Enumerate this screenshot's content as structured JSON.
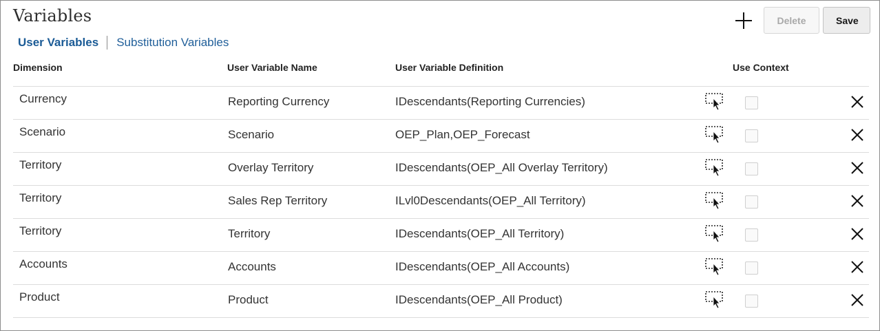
{
  "page": {
    "title": "Variables"
  },
  "toolbar": {
    "add_icon": "plus-icon",
    "delete_label": "Delete",
    "save_label": "Save"
  },
  "tabs": [
    {
      "label": "User Variables",
      "active": true
    },
    {
      "label": "Substitution Variables",
      "active": false
    }
  ],
  "columns": {
    "dimension": "Dimension",
    "name": "User Variable Name",
    "definition": "User Variable Definition",
    "context": "Use Context"
  },
  "rows": [
    {
      "dimension": "Currency",
      "name": "Reporting Currency",
      "definition": "IDescendants(Reporting Currencies)",
      "use_context": false
    },
    {
      "dimension": "Scenario",
      "name": "Scenario",
      "definition": "OEP_Plan,OEP_Forecast",
      "use_context": false
    },
    {
      "dimension": "Territory",
      "name": "Overlay Territory",
      "definition": "IDescendants(OEP_All Overlay Territory)",
      "use_context": false
    },
    {
      "dimension": "Territory",
      "name": "Sales Rep Territory",
      "definition": "ILvl0Descendants(OEP_All Territory)",
      "use_context": false
    },
    {
      "dimension": "Territory",
      "name": "Territory",
      "definition": "IDescendants(OEP_All Territory)",
      "use_context": false
    },
    {
      "dimension": "Accounts",
      "name": "Accounts",
      "definition": "IDescendants(OEP_All Accounts)",
      "use_context": false
    },
    {
      "dimension": "Product",
      "name": "Product",
      "definition": "IDescendants(OEP_All Product)",
      "use_context": false
    }
  ],
  "icons": {
    "member_selector": "member-selector-icon",
    "remove": "close-icon"
  },
  "colors": {
    "link": "#1f5e99",
    "active_tab": "#1b5b96",
    "border": "#dcdcdc"
  }
}
